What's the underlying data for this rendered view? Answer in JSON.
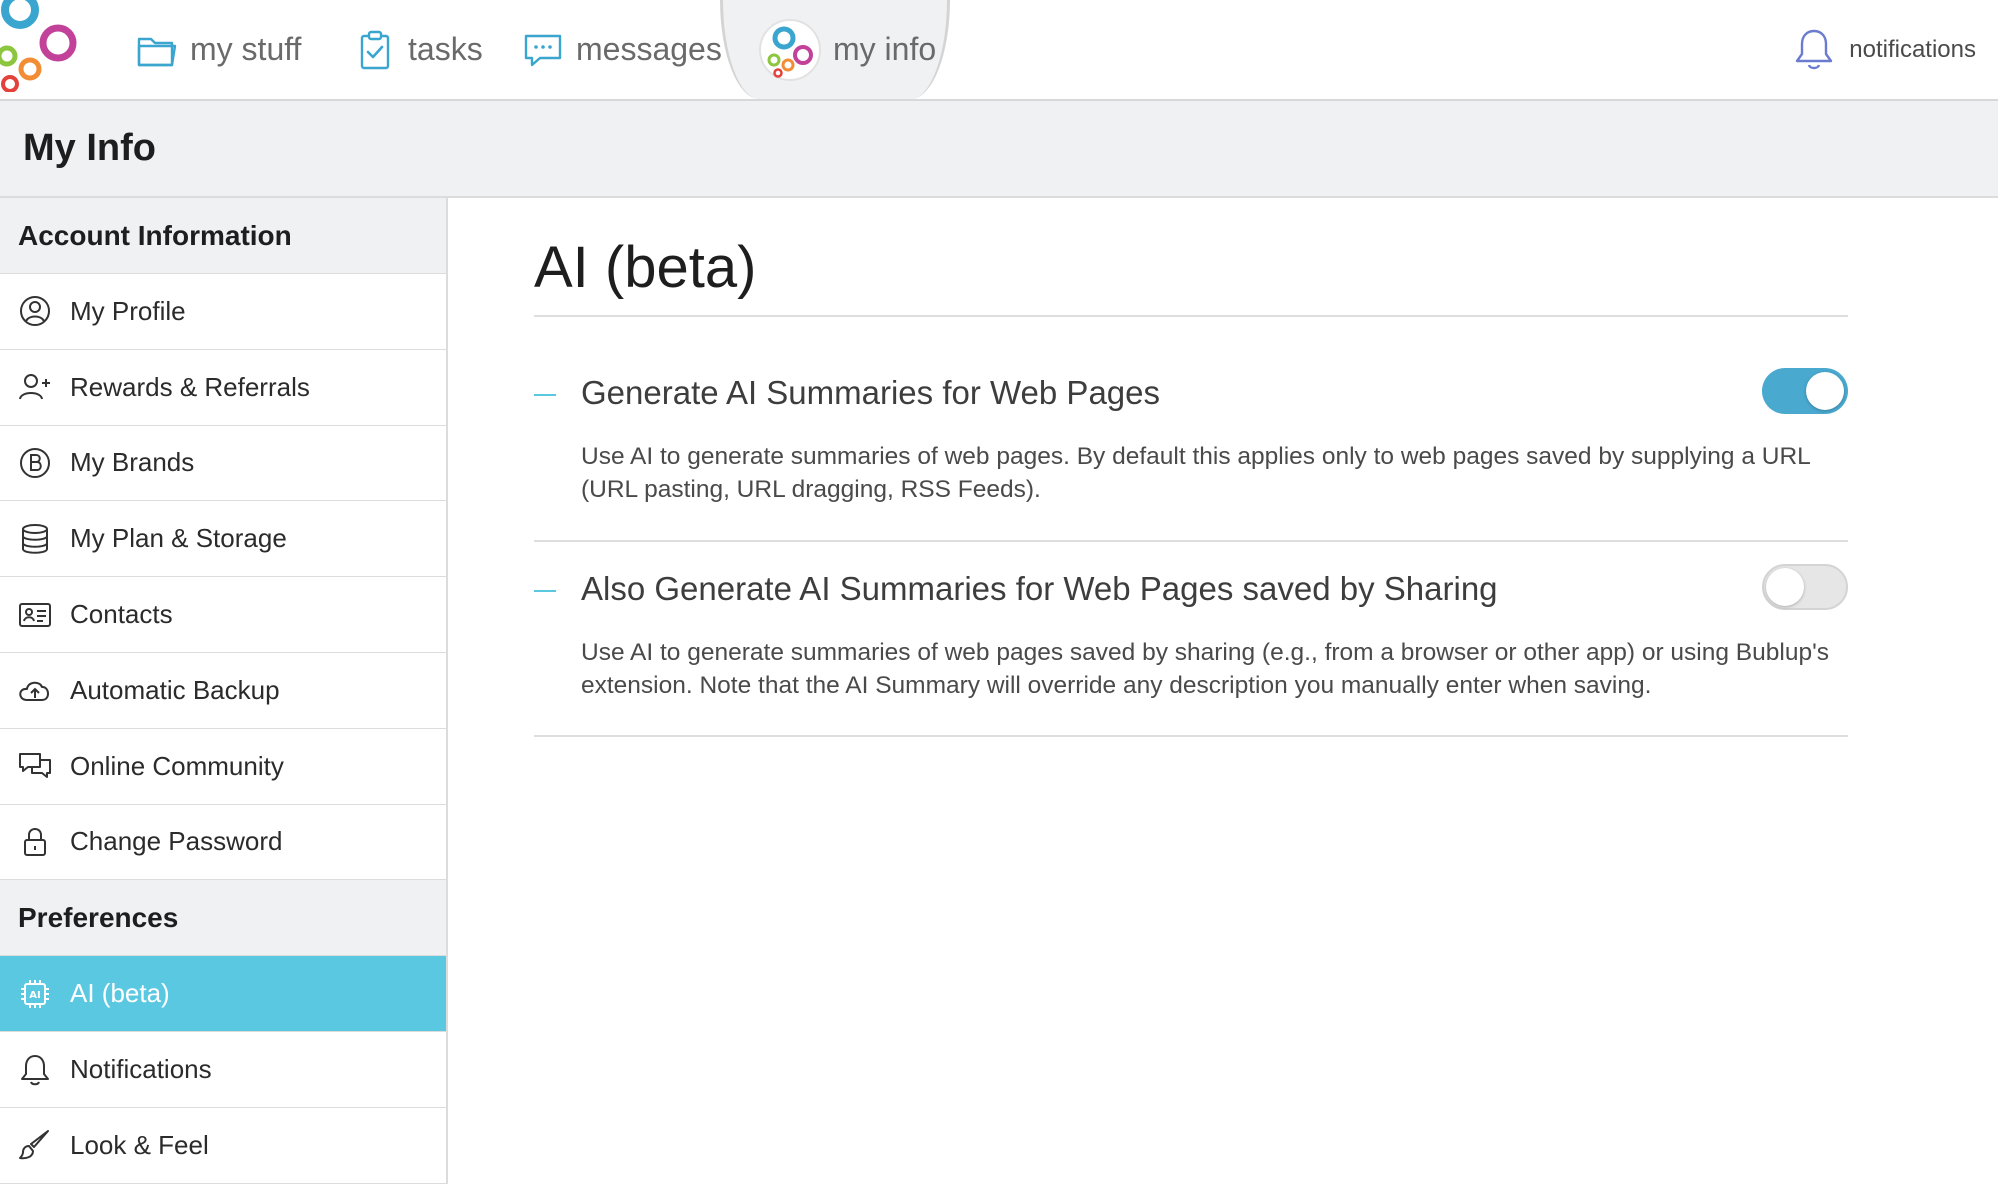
{
  "nav": {
    "tabs": [
      {
        "label": "my stuff",
        "icon": "folder-icon"
      },
      {
        "label": "tasks",
        "icon": "clipboard-check-icon"
      },
      {
        "label": "messages",
        "icon": "chat-bubble-icon"
      },
      {
        "label": "my info",
        "icon": "avatar-icon",
        "active": true
      }
    ],
    "notifications": {
      "label": "notifications",
      "icon": "bell-icon"
    }
  },
  "header": {
    "title": "My Info"
  },
  "sidebar": {
    "sections": [
      {
        "title": "Account Information",
        "items": [
          {
            "label": "My Profile",
            "icon": "user-circle-icon"
          },
          {
            "label": "Rewards & Referrals",
            "icon": "user-plus-icon"
          },
          {
            "label": "My Brands",
            "icon": "brand-b-icon"
          },
          {
            "label": "My Plan & Storage",
            "icon": "database-icon"
          },
          {
            "label": "Contacts",
            "icon": "contact-card-icon"
          },
          {
            "label": "Automatic Backup",
            "icon": "cloud-upload-icon"
          },
          {
            "label": "Online Community",
            "icon": "chat-bubbles-icon"
          },
          {
            "label": "Change Password",
            "icon": "lock-icon"
          }
        ]
      },
      {
        "title": "Preferences",
        "items": [
          {
            "label": "AI (beta)",
            "icon": "ai-chip-icon",
            "active": true
          },
          {
            "label": "Notifications",
            "icon": "bell-icon"
          },
          {
            "label": "Look & Feel",
            "icon": "paintbrush-icon"
          }
        ]
      }
    ]
  },
  "main": {
    "title": "AI (beta)",
    "settings": [
      {
        "label": "Generate AI Summaries for Web Pages",
        "description": "Use AI to generate summaries of web pages. By default this applies only to web pages saved by supplying a URL (URL pasting, URL dragging, RSS Feeds).",
        "enabled": true
      },
      {
        "label": "Also Generate AI Summaries for Web Pages saved by Sharing",
        "description": "Use AI to generate summaries of web pages saved by sharing (e.g., from a browser or other app) or using Bublup's extension. Note that the AI Summary will override any description you manually enter when saving.",
        "enabled": false
      }
    ]
  },
  "colors": {
    "accent": "#5bc8e2",
    "toggle_on": "#4aa9cf",
    "header_bg": "#f0f1f2",
    "logo_blue": "#3aa6cf",
    "logo_magenta": "#c2429a",
    "logo_orange": "#f28d35",
    "logo_green": "#8cc63f"
  }
}
